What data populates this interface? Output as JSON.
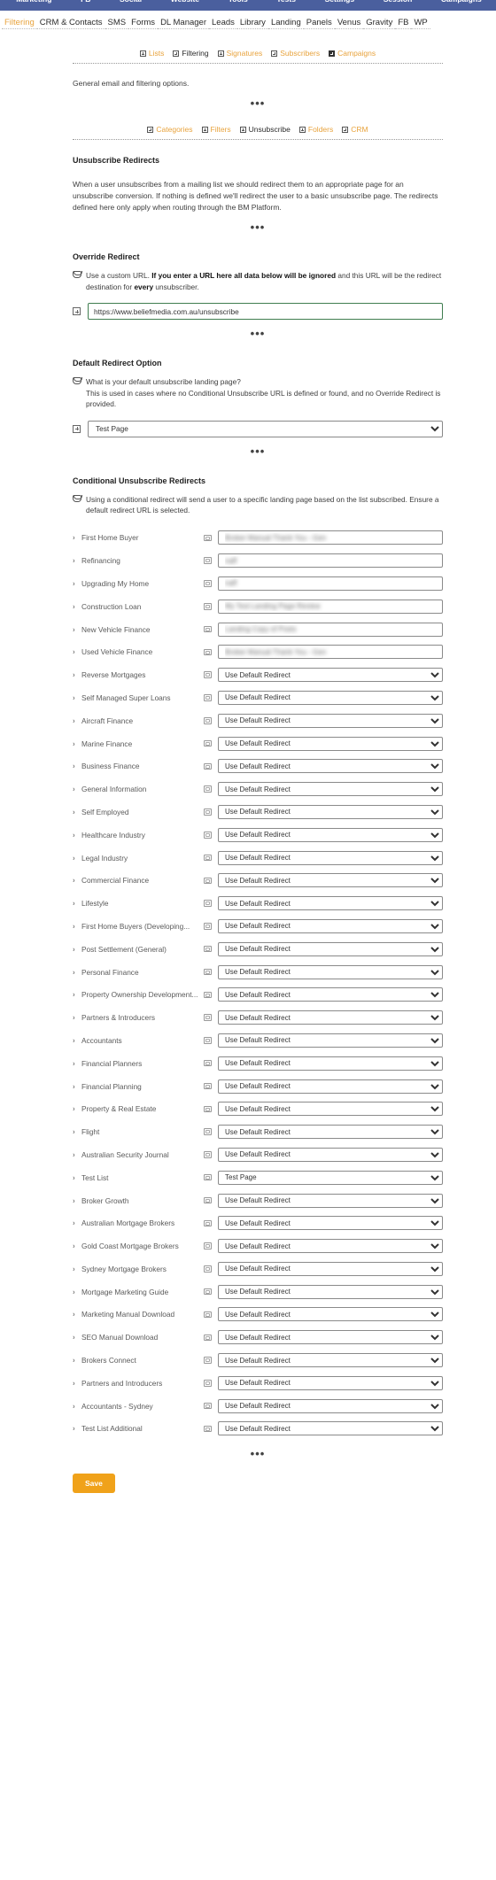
{
  "topnav": {
    "items": [
      "Marketing",
      "FB",
      "Social",
      "Website",
      "Tools",
      "Tests",
      "Settings",
      "Session",
      "Campaigns"
    ]
  },
  "subnav": {
    "items": [
      {
        "label": "Filtering",
        "active": true
      },
      {
        "label": "CRM & Contacts",
        "active": false
      },
      {
        "label": "SMS",
        "active": false
      },
      {
        "label": "Forms",
        "active": false
      },
      {
        "label": "DL Manager",
        "active": false
      },
      {
        "label": "Leads",
        "active": false
      },
      {
        "label": "Library",
        "active": false
      },
      {
        "label": "Landing",
        "active": false
      },
      {
        "label": "Panels",
        "active": false
      },
      {
        "label": "Venus",
        "active": false
      },
      {
        "label": "Gravity",
        "active": false
      },
      {
        "label": "FB",
        "active": false
      },
      {
        "label": "WP",
        "active": false
      }
    ]
  },
  "plusrow1": {
    "items": [
      {
        "label": "Lists",
        "orange": true,
        "filled": false
      },
      {
        "label": "Filtering",
        "orange": false,
        "filled": false
      },
      {
        "label": "Signatures",
        "orange": true,
        "filled": false
      },
      {
        "label": "Subscribers",
        "orange": true,
        "filled": false
      },
      {
        "label": "Campaigns",
        "orange": true,
        "filled": true
      }
    ]
  },
  "intro_text": "General email and filtering options.",
  "plusrow2": {
    "items": [
      {
        "label": "Categories",
        "orange": true,
        "filled": false
      },
      {
        "label": "Filters",
        "orange": true,
        "filled": false
      },
      {
        "label": "Unsubscribe",
        "orange": false,
        "filled": false
      },
      {
        "label": "Folders",
        "orange": true,
        "filled": false
      },
      {
        "label": "CRM",
        "orange": true,
        "filled": false
      }
    ]
  },
  "ellipsis": "•••",
  "unsubscribe_redirects": {
    "heading": "Unsubscribe Redirects",
    "body": "When a user unsubscribes from a mailing list we should redirect them to an appropriate page for an unsubscribe conversion. If nothing is defined we'll redirect the user to a basic unsubscribe page. The redirects defined here only apply when routing through the BM Platform."
  },
  "override_redirect": {
    "heading": "Override Redirect",
    "note_part1": "Use a custom URL. ",
    "note_bold1": "If you enter a URL here all data below will be ignored",
    "note_part2": " and this URL will be the redirect destination for ",
    "note_bold2": "every",
    "note_part3": " unsubscriber.",
    "input_value": "https://www.beliefmedia.com.au/unsubscribe",
    "input_placeholder": "https://"
  },
  "default_redirect": {
    "heading": "Default Redirect Option",
    "note_line1": "What is your default unsubscribe landing page?",
    "note_line2": "This is used in cases where no Conditional Unsubscribe URL is defined or found, and no Override Redirect is provided.",
    "selected": "Test Page",
    "options": [
      "Test Page",
      "Use Default Redirect"
    ]
  },
  "conditional": {
    "heading": "Conditional Unsubscribe Redirects",
    "note": "Using a conditional redirect will send a user to a specific landing page based on the list subscribed. Ensure a default redirect URL is selected.",
    "default_option": "Use Default Redirect",
    "rows": [
      {
        "name": "First Home Buyer",
        "value": "Broker Manual Thank You - Gen",
        "redacted": true
      },
      {
        "name": "Refinancing",
        "value": "naff",
        "redacted": true
      },
      {
        "name": "Upgrading My Home",
        "value": "naff",
        "redacted": true
      },
      {
        "name": "Construction Loan",
        "value": "My Test Landing Page Review",
        "redacted": true
      },
      {
        "name": "New Vehicle Finance",
        "value": "Landing Copy of Posts",
        "redacted": true
      },
      {
        "name": "Used Vehicle Finance",
        "value": "Broker Manual Thank You - Gen",
        "redacted": true
      },
      {
        "name": "Reverse Mortgages",
        "value": "Use Default Redirect",
        "redacted": false
      },
      {
        "name": "Self Managed Super Loans",
        "value": "Use Default Redirect",
        "redacted": false
      },
      {
        "name": "Aircraft Finance",
        "value": "Use Default Redirect",
        "redacted": false
      },
      {
        "name": "Marine Finance",
        "value": "Use Default Redirect",
        "redacted": false
      },
      {
        "name": "Business Finance",
        "value": "Use Default Redirect",
        "redacted": false
      },
      {
        "name": "General Information",
        "value": "Use Default Redirect",
        "redacted": false
      },
      {
        "name": "Self Employed",
        "value": "Use Default Redirect",
        "redacted": false
      },
      {
        "name": "Healthcare Industry",
        "value": "Use Default Redirect",
        "redacted": false
      },
      {
        "name": "Legal Industry",
        "value": "Use Default Redirect",
        "redacted": false
      },
      {
        "name": "Commercial Finance",
        "value": "Use Default Redirect",
        "redacted": false
      },
      {
        "name": "Lifestyle",
        "value": "Use Default Redirect",
        "redacted": false
      },
      {
        "name": "First Home Buyers (Developing...",
        "value": "Use Default Redirect",
        "redacted": false
      },
      {
        "name": "Post Settlement (General)",
        "value": "Use Default Redirect",
        "redacted": false
      },
      {
        "name": "Personal Finance",
        "value": "Use Default Redirect",
        "redacted": false
      },
      {
        "name": "Property Ownership Development...",
        "value": "Use Default Redirect",
        "redacted": false
      },
      {
        "name": "Partners & Introducers",
        "value": "Use Default Redirect",
        "redacted": false
      },
      {
        "name": "Accountants",
        "value": "Use Default Redirect",
        "redacted": false
      },
      {
        "name": "Financial Planners",
        "value": "Use Default Redirect",
        "redacted": false
      },
      {
        "name": "Financial Planning",
        "value": "Use Default Redirect",
        "redacted": false
      },
      {
        "name": "Property & Real Estate",
        "value": "Use Default Redirect",
        "redacted": false
      },
      {
        "name": "Flight",
        "value": "Use Default Redirect",
        "redacted": false
      },
      {
        "name": "Australian Security Journal",
        "value": "Use Default Redirect",
        "redacted": false
      },
      {
        "name": "Test List",
        "value": "Test Page",
        "redacted": false
      },
      {
        "name": "Broker Growth",
        "value": "Use Default Redirect",
        "redacted": false
      },
      {
        "name": "Australian Mortgage Brokers",
        "value": "Use Default Redirect",
        "redacted": false
      },
      {
        "name": "Gold Coast Mortgage Brokers",
        "value": "Use Default Redirect",
        "redacted": false
      },
      {
        "name": "Sydney Mortgage Brokers",
        "value": "Use Default Redirect",
        "redacted": false
      },
      {
        "name": "Mortgage Marketing Guide",
        "value": "Use Default Redirect",
        "redacted": false
      },
      {
        "name": "Marketing Manual Download",
        "value": "Use Default Redirect",
        "redacted": false
      },
      {
        "name": "SEO Manual Download",
        "value": "Use Default Redirect",
        "redacted": false
      },
      {
        "name": "Brokers Connect",
        "value": "Use Default Redirect",
        "redacted": false
      },
      {
        "name": "Partners and Introducers",
        "value": "Use Default Redirect",
        "redacted": false
      },
      {
        "name": "Accountants - Sydney",
        "value": "Use Default Redirect",
        "redacted": false
      },
      {
        "name": "Test List Additional",
        "value": "Use Default Redirect",
        "redacted": false
      }
    ]
  },
  "save_label": "Save"
}
